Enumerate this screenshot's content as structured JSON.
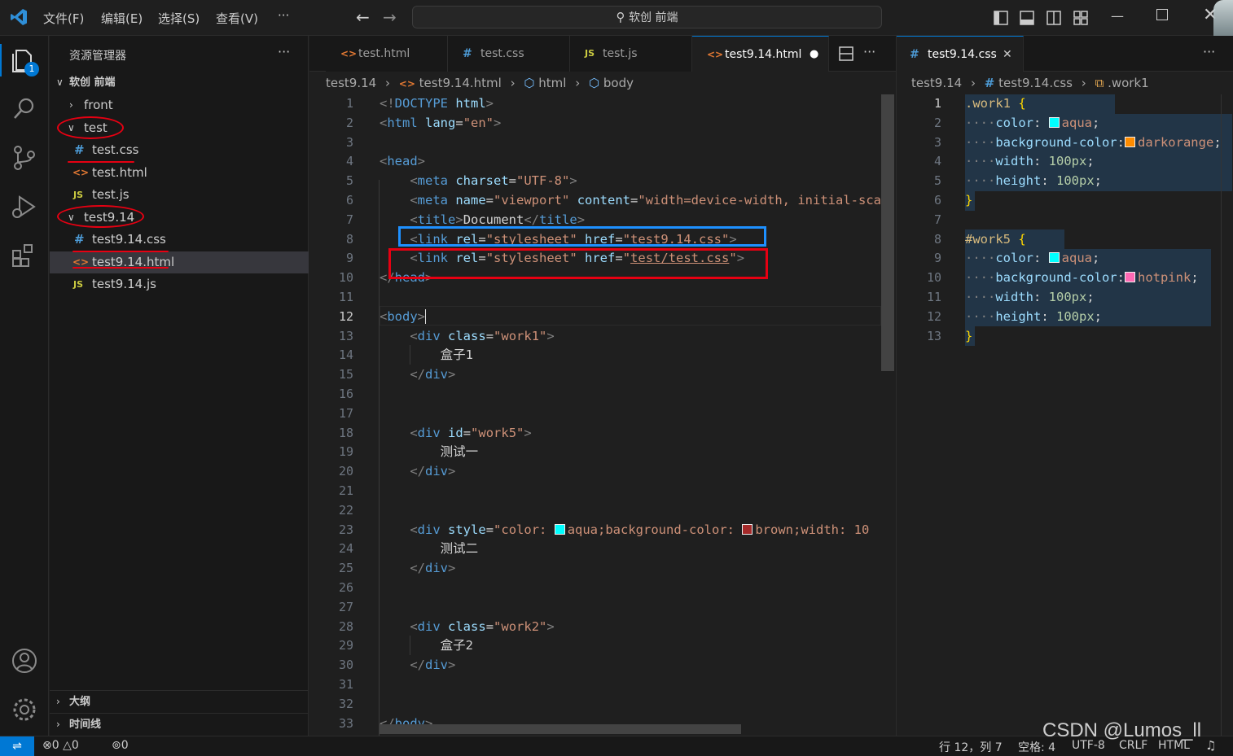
{
  "titlebar": {
    "menus": [
      "文件(F)",
      "编辑(E)",
      "选择(S)",
      "查看(V)"
    ],
    "more": "···",
    "search_text": "软创 前端"
  },
  "activity": {
    "badge": "1"
  },
  "explorer": {
    "title": "资源管理器",
    "more": "···",
    "root": "软创 前端",
    "items": [
      {
        "label": "front",
        "type": "folder",
        "open": false
      },
      {
        "label": "test",
        "type": "folder",
        "open": true
      },
      {
        "label": "test.css",
        "type": "css"
      },
      {
        "label": "test.html",
        "type": "html"
      },
      {
        "label": "test.js",
        "type": "js"
      },
      {
        "label": "test9.14",
        "type": "folder",
        "open": true
      },
      {
        "label": "test9.14.css",
        "type": "css"
      },
      {
        "label": "test9.14.html",
        "type": "html",
        "selected": true
      },
      {
        "label": "test9.14.js",
        "type": "js"
      }
    ],
    "outline": "大纲",
    "timeline": "时间线"
  },
  "editor1": {
    "tabs": [
      {
        "label": "test.html",
        "type": "html"
      },
      {
        "label": "test.css",
        "type": "css"
      },
      {
        "label": "test.js",
        "type": "js"
      },
      {
        "label": "test9.14.html",
        "type": "html",
        "active": true,
        "dirty": true
      }
    ],
    "breadcrumbs": [
      "test9.14",
      "test9.14.html",
      "html",
      "body"
    ],
    "current_line": 12,
    "lines": [
      "1",
      "2",
      "3",
      "4",
      "5",
      "6",
      "7",
      "8",
      "9",
      "10",
      "11",
      "12",
      "13",
      "14",
      "15",
      "16",
      "17",
      "18",
      "19",
      "20",
      "21",
      "22",
      "23",
      "24",
      "25",
      "26",
      "27",
      "28",
      "29",
      "30",
      "31",
      "32",
      "33"
    ]
  },
  "editor2": {
    "tab": {
      "label": "test9.14.css",
      "type": "css"
    },
    "breadcrumbs": [
      "test9.14",
      "test9.14.css",
      ".work1"
    ],
    "lines": [
      "1",
      "2",
      "3",
      "4",
      "5",
      "6",
      "7",
      "8",
      "9",
      "10",
      "11",
      "12",
      "13"
    ]
  },
  "status": {
    "errors": "0",
    "warnings": "0",
    "ports": "0",
    "position": "行 12，列 7",
    "spaces": "空格: 4",
    "encoding": "UTF-8",
    "eol": "CRLF",
    "language": "HTML"
  },
  "watermark": "CSDN @Lumos_ll",
  "colors": {
    "aqua": "#00ffff",
    "darkorange": "#ff8c00",
    "hotpink": "#ff69b4",
    "brown": "#a52a2a",
    "annotation_red": "#e60012",
    "annotation_blue": "#1e90ff"
  }
}
